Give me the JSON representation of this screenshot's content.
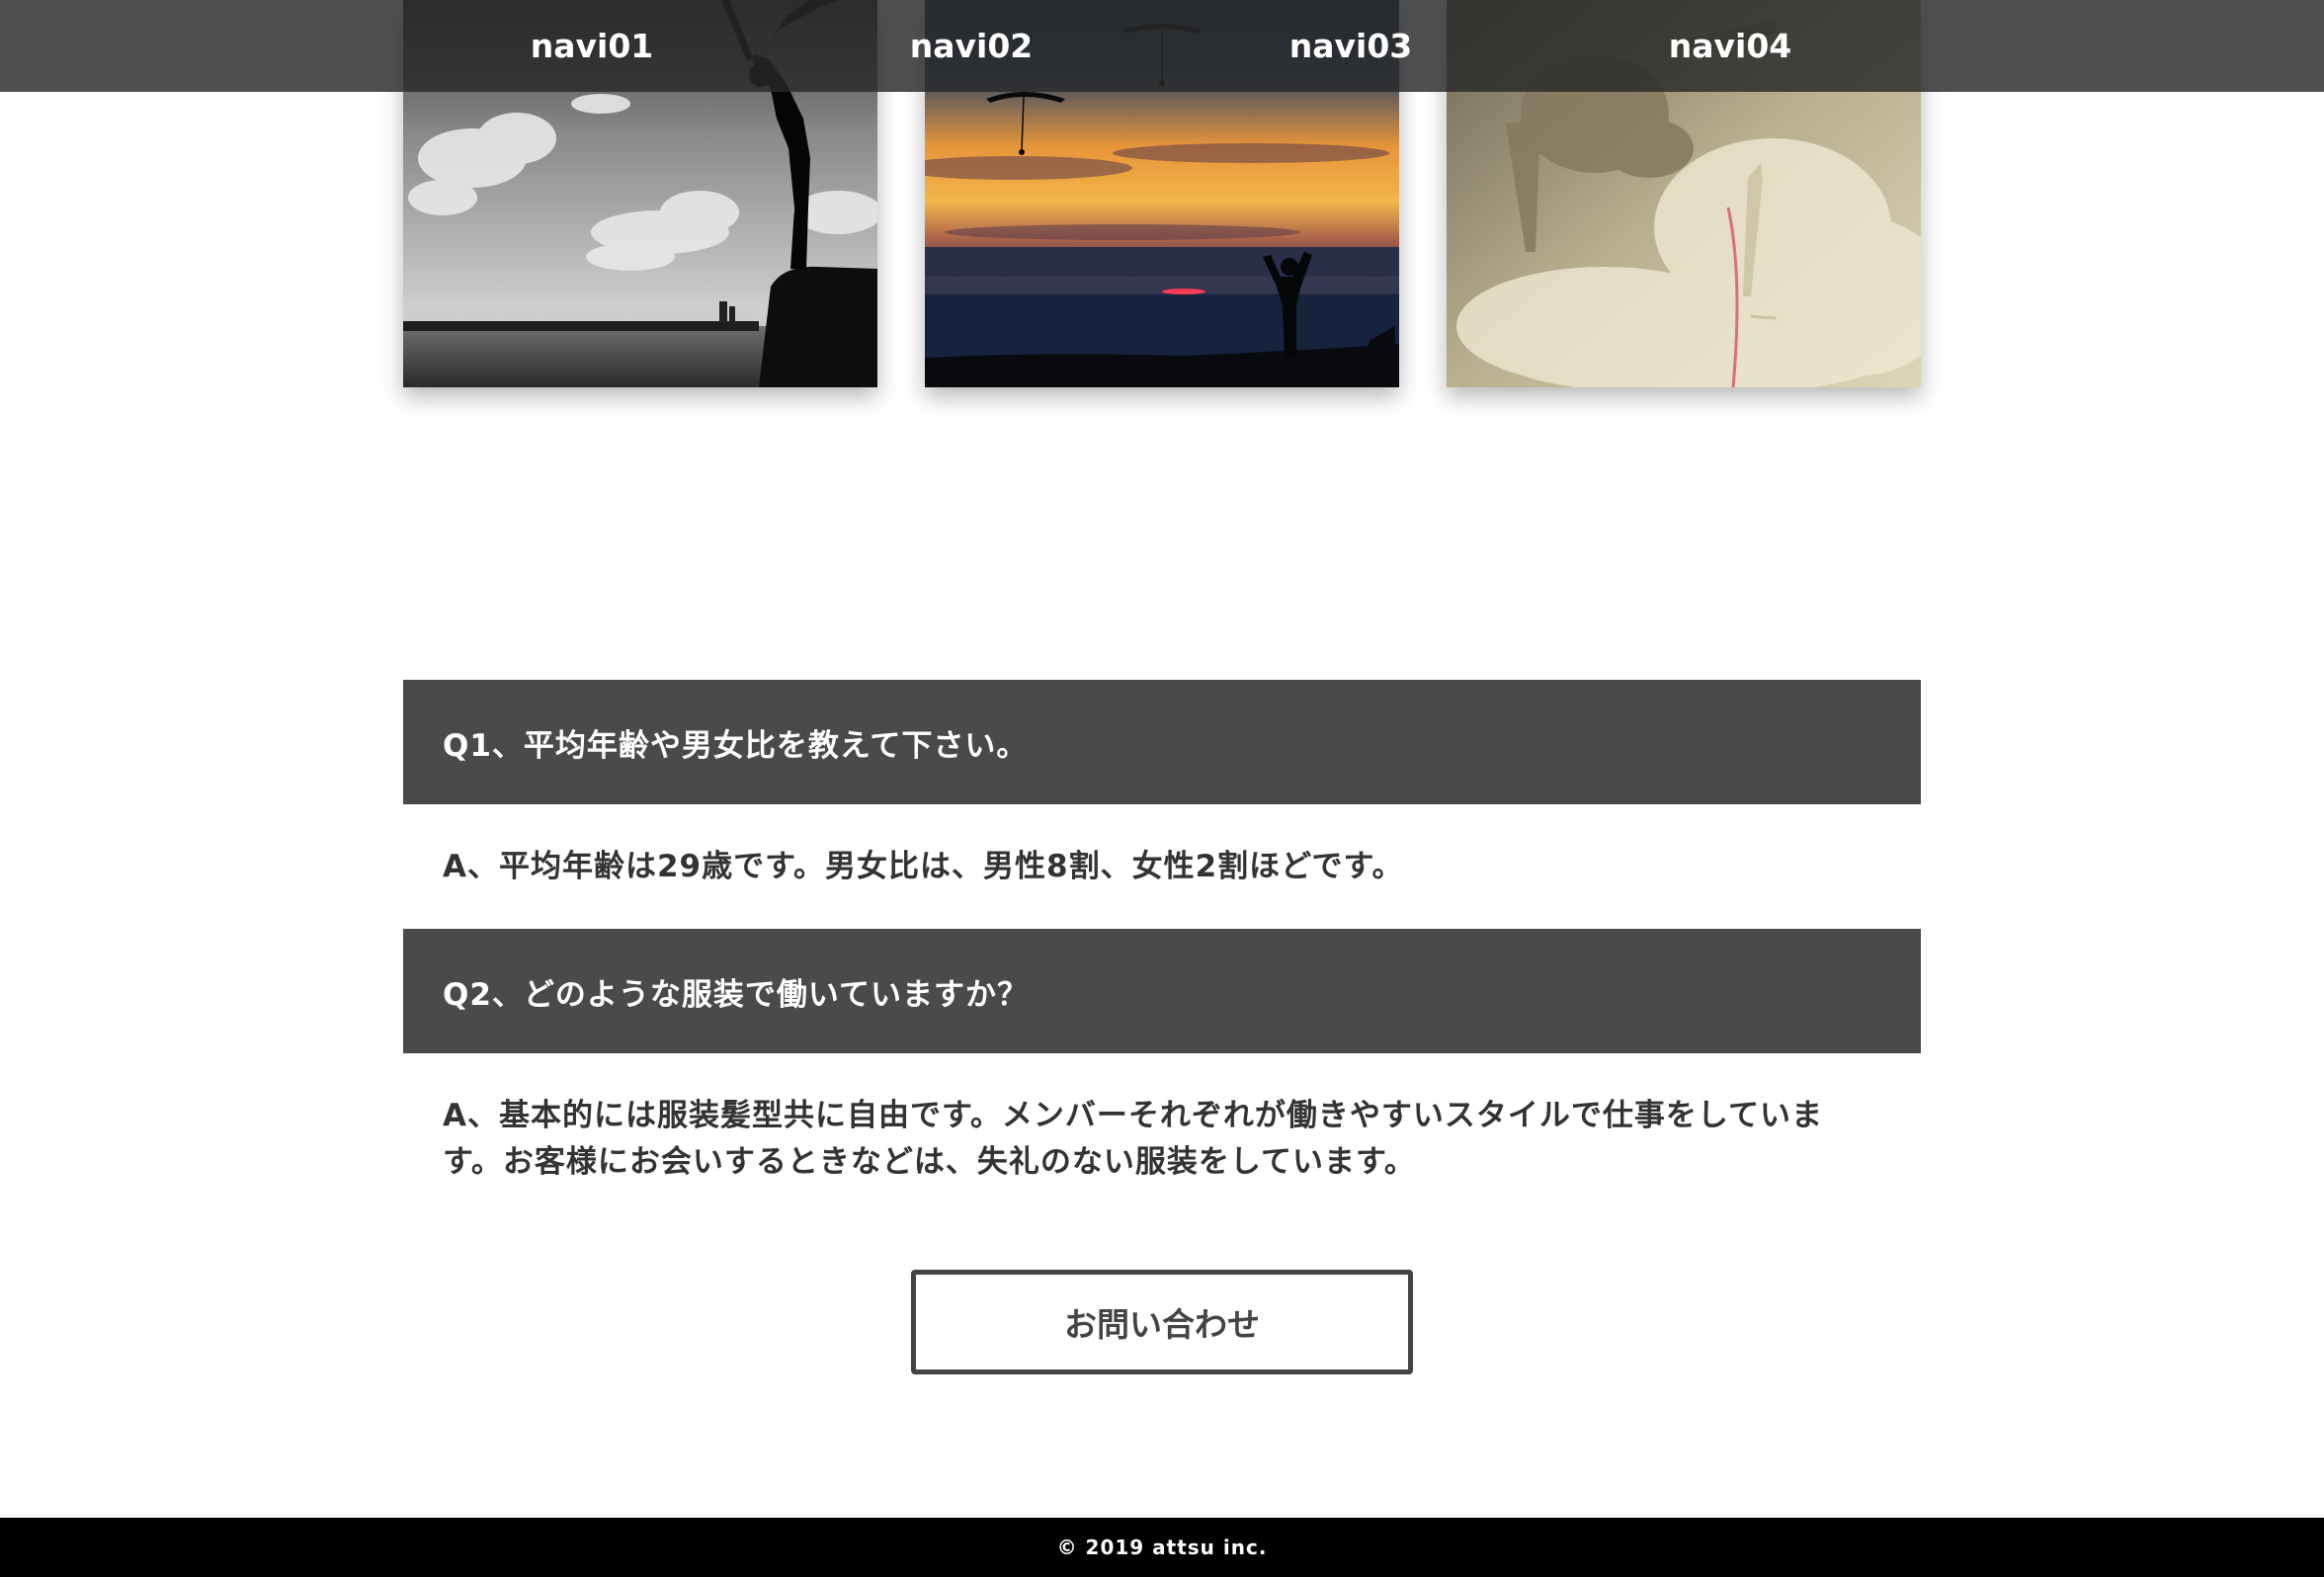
{
  "nav": {
    "items": [
      {
        "label": "navi01"
      },
      {
        "label": "navi02"
      },
      {
        "label": "navi03"
      },
      {
        "label": "navi04"
      }
    ]
  },
  "faq": [
    {
      "question": "Q1、平均年齢や男女比を教えて下さい。",
      "answer": "A、平均年齢は29歳です。男女比は、男性8割、女性2割ほどです。"
    },
    {
      "question": "Q2、どのような服装で働いていますか？",
      "answer": "A、基本的には服装髪型共に自由です。メンバーそれぞれが働きやすいスタイルで仕事をしています。お客様にお会いするときなどは、失礼のない服装をしています。"
    }
  ],
  "contact": {
    "label": "お問い合わせ"
  },
  "footer": {
    "copyright": "© 2019 attsu inc."
  },
  "colors": {
    "header_bg": "#282828",
    "question_bg": "#4a4a4a",
    "text": "#333333",
    "footer_bg": "#000000"
  }
}
